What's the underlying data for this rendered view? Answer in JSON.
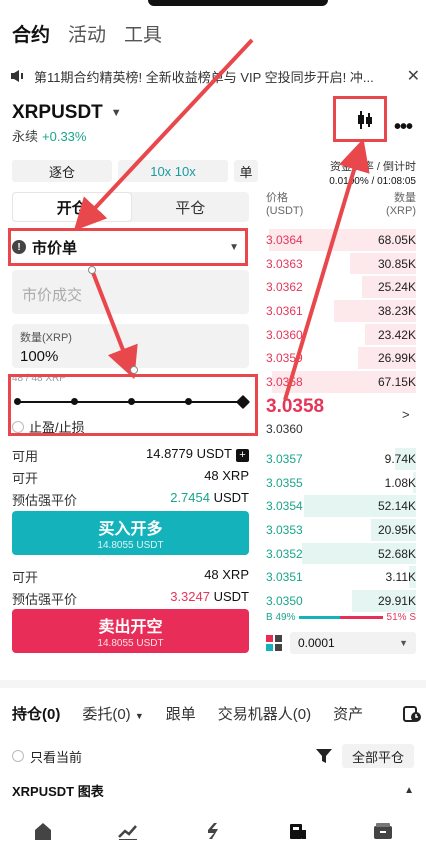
{
  "top_tabs": [
    "合约",
    "活动",
    "工具"
  ],
  "announcement": {
    "text": "第11期合约精英榜! 全新收益榜单与 VIP 空投同步开启! 冲...",
    "close": "✕"
  },
  "symbol": {
    "name": "XRPUSDT",
    "type": "永续",
    "change": "+0.33%"
  },
  "margin": {
    "mode": "逐仓",
    "leverage": "10x 10x",
    "unit": "单"
  },
  "open_close": {
    "open": "开仓",
    "close": "平仓"
  },
  "order_type": {
    "label": "市价单"
  },
  "price_input": {
    "placeholder": "市价成交"
  },
  "quantity": {
    "label": "数量(XRP)",
    "value": "100%"
  },
  "slider": {
    "hint": "48 / 48 XRP",
    "value_percent": 100
  },
  "tpsl": {
    "label": "止盈/止损"
  },
  "available": {
    "label": "可用",
    "value": "14.8779 USDT"
  },
  "buy_info": {
    "can_open_label": "可开",
    "can_open_value": "48 XRP",
    "liq_label": "预估强平价",
    "liq_value": "2.7454",
    "liq_unit": "USDT"
  },
  "buy_button": {
    "label": "买入开多",
    "sub": "14.8055 USDT"
  },
  "sell_info": {
    "can_open_label": "可开",
    "can_open_value": "48 XRP",
    "liq_label": "预估强平价",
    "liq_value": "3.3247",
    "liq_unit": "USDT"
  },
  "sell_button": {
    "label": "卖出开空",
    "sub": "14.8055 USDT"
  },
  "funding": {
    "label": "资金费率 / 倒计时",
    "value": "0.0100% / 01:08:05"
  },
  "orderbook": {
    "price_header": "价格",
    "price_unit": "(USDT)",
    "qty_header": "数量",
    "qty_unit": "(XRP)",
    "asks": [
      {
        "price": "3.0364",
        "qty": "68.05K",
        "depth": 0.98
      },
      {
        "price": "3.0363",
        "qty": "30.85K",
        "depth": 0.44
      },
      {
        "price": "3.0362",
        "qty": "25.24K",
        "depth": 0.36
      },
      {
        "price": "3.0361",
        "qty": "38.23K",
        "depth": 0.55
      },
      {
        "price": "3.0360",
        "qty": "23.42K",
        "depth": 0.34
      },
      {
        "price": "3.0359",
        "qty": "26.99K",
        "depth": 0.39
      },
      {
        "price": "3.0358",
        "qty": "67.15K",
        "depth": 0.96
      }
    ],
    "last_price": "3.0358",
    "mark_price": "3.0360",
    "bids": [
      {
        "price": "3.0357",
        "qty": "9.74K",
        "depth": 0.14
      },
      {
        "price": "3.0355",
        "qty": "1.08K",
        "depth": 0.02
      },
      {
        "price": "3.0354",
        "qty": "52.14K",
        "depth": 0.75
      },
      {
        "price": "3.0353",
        "qty": "20.95K",
        "depth": 0.3
      },
      {
        "price": "3.0352",
        "qty": "52.68K",
        "depth": 0.76
      },
      {
        "price": "3.0351",
        "qty": "3.11K",
        "depth": 0.05
      },
      {
        "price": "3.0350",
        "qty": "29.91K",
        "depth": 0.43
      }
    ],
    "buy_ratio": "B 49%",
    "sell_ratio": "51% S",
    "buy_ratio_value": 49,
    "depth_step": "0.0001"
  },
  "bottom_tabs": [
    "持仓(0)",
    "委托(0)",
    "跟单",
    "交易机器人(0)",
    "资产"
  ],
  "only_current": "只看当前",
  "close_all": "全部平仓",
  "chart_label": "XRPUSDT 图表",
  "colors": {
    "buy": "#14b3bc",
    "sell": "#e82e58",
    "up": "#1aa58a",
    "down": "#e5365a",
    "annotation": "#e8474c"
  },
  "icons": [
    "speaker-icon",
    "close-icon",
    "candlestick-icon",
    "more-icon",
    "info-icon",
    "caret-down-icon",
    "plus-icon",
    "chevron-right-icon",
    "depth-icon",
    "clock-icon",
    "funnel-icon",
    "chevron-up-icon",
    "home-icon",
    "markets-icon",
    "trade-icon",
    "futures-icon",
    "wallet-icon"
  ]
}
